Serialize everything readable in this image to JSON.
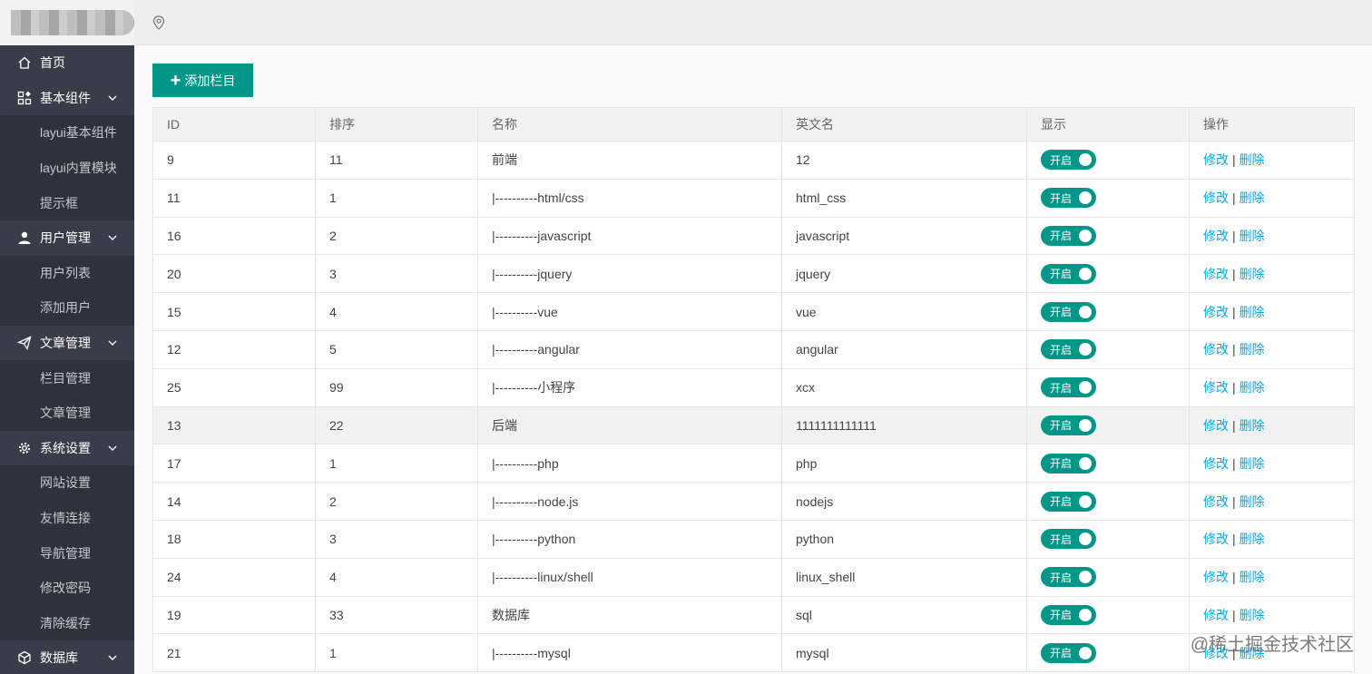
{
  "header": {
    "location_icon": "map-pin-icon"
  },
  "sidebar": {
    "groups": [
      {
        "icon": "home-icon",
        "label": "首页",
        "expandable": false,
        "items": []
      },
      {
        "icon": "grid-icon",
        "label": "基本组件",
        "expandable": true,
        "items": [
          "layui基本组件",
          "layui内置模块",
          "提示框"
        ]
      },
      {
        "icon": "user-icon",
        "label": "用户管理",
        "expandable": true,
        "items": [
          "用户列表",
          "添加用户"
        ]
      },
      {
        "icon": "send-icon",
        "label": "文章管理",
        "expandable": true,
        "items": [
          "栏目管理",
          "文章管理"
        ]
      },
      {
        "icon": "gear-icon",
        "label": "系统设置",
        "expandable": true,
        "items": [
          "网站设置",
          "友情连接",
          "导航管理",
          "修改密码",
          "清除缓存"
        ]
      },
      {
        "icon": "cube-icon",
        "label": "数据库",
        "expandable": true,
        "items": []
      }
    ]
  },
  "toolbar": {
    "add_label": "添加栏目"
  },
  "table": {
    "columns": [
      "ID",
      "排序",
      "名称",
      "英文名",
      "显示",
      "操作"
    ],
    "rows": [
      {
        "id": "9",
        "sort": "11",
        "name": "前端",
        "en": "12",
        "show": "开启",
        "highlight": false
      },
      {
        "id": "11",
        "sort": "1",
        "name": "|----------html/css",
        "en": "html_css",
        "show": "开启",
        "highlight": false
      },
      {
        "id": "16",
        "sort": "2",
        "name": "|----------javascript",
        "en": "javascript",
        "show": "开启",
        "highlight": false
      },
      {
        "id": "20",
        "sort": "3",
        "name": "|----------jquery",
        "en": "jquery",
        "show": "开启",
        "highlight": false
      },
      {
        "id": "15",
        "sort": "4",
        "name": "|----------vue",
        "en": "vue",
        "show": "开启",
        "highlight": false
      },
      {
        "id": "12",
        "sort": "5",
        "name": "|----------angular",
        "en": "angular",
        "show": "开启",
        "highlight": false
      },
      {
        "id": "25",
        "sort": "99",
        "name": "|----------小程序",
        "en": "xcx",
        "show": "开启",
        "highlight": false
      },
      {
        "id": "13",
        "sort": "22",
        "name": "后端",
        "en": "1111111111111",
        "show": "开启",
        "highlight": true
      },
      {
        "id": "17",
        "sort": "1",
        "name": "|----------php",
        "en": "php",
        "show": "开启",
        "highlight": false
      },
      {
        "id": "14",
        "sort": "2",
        "name": "|----------node.js",
        "en": "nodejs",
        "show": "开启",
        "highlight": false
      },
      {
        "id": "18",
        "sort": "3",
        "name": "|----------python",
        "en": "python",
        "show": "开启",
        "highlight": false
      },
      {
        "id": "24",
        "sort": "4",
        "name": "|----------linux/shell",
        "en": "linux_shell",
        "show": "开启",
        "highlight": false
      },
      {
        "id": "19",
        "sort": "33",
        "name": "数据库",
        "en": "sql",
        "show": "开启",
        "highlight": false
      },
      {
        "id": "21",
        "sort": "1",
        "name": "|----------mysql",
        "en": "mysql",
        "show": "开启",
        "highlight": false
      }
    ],
    "actions": {
      "edit": "修改",
      "separator": "|",
      "delete": "删除"
    }
  },
  "watermark": "@稀土掘金技术社区",
  "colors": {
    "accent": "#009688",
    "link": "#01aaed",
    "sidebar_bg": "#393d49",
    "sidebar_sub_bg": "#2e323c"
  }
}
